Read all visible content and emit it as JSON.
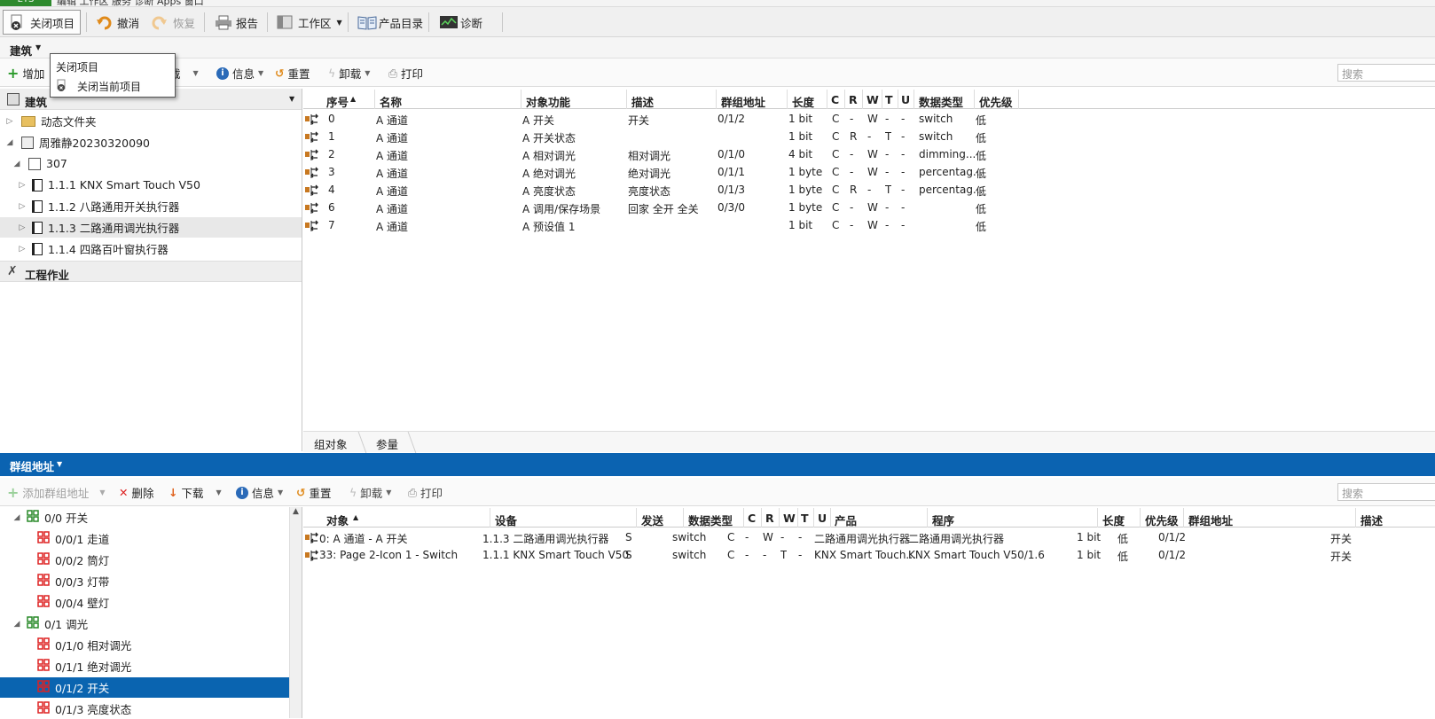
{
  "app": {
    "badge": "ETS",
    "menu": "编辑   工作区   服务   诊断   Apps   窗口"
  },
  "toolbar": {
    "close_project": "关闭项目",
    "undo": "撤消",
    "redo": "恢复",
    "report": "报告",
    "workspace": "工作区",
    "catalog": "产品目录",
    "diagnostics": "诊断"
  },
  "popup": {
    "title": "关闭项目",
    "item": "关闭当前项目"
  },
  "building_panel": {
    "title": "建筑",
    "toolbar": {
      "add": "增加",
      "delete": "删除",
      "download": "下载",
      "info": "信息",
      "reset": "重置",
      "unload": "卸载",
      "print": "打印",
      "search_placeholder": "搜索"
    },
    "tree_header": "建筑",
    "tree": [
      {
        "label": "动态文件夹"
      },
      {
        "label": "周雅静20230320090"
      },
      {
        "label": "307"
      },
      {
        "label": "1.1.1 KNX Smart Touch V50"
      },
      {
        "label": "1.1.2 八路通用开关执行器"
      },
      {
        "label": "1.1.3 二路通用调光执行器"
      },
      {
        "label": "1.1.4 四路百叶窗执行器"
      }
    ],
    "work_section": "工程作业"
  },
  "objects_grid": {
    "headers": {
      "num": "序号",
      "name": "名称",
      "func": "对象功能",
      "desc": "描述",
      "ga": "群组地址",
      "len": "长度",
      "c": "C",
      "r": "R",
      "w": "W",
      "t": "T",
      "u": "U",
      "dtype": "数据类型",
      "prio": "优先级"
    },
    "rows": [
      {
        "num": "0",
        "name": "A 通道",
        "func": "A 开关",
        "desc": "开关",
        "ga": "0/1/2",
        "len": "1 bit",
        "c": "C",
        "r": "-",
        "w": "W",
        "t": "-",
        "u": "-",
        "dtype": "switch",
        "prio": "低"
      },
      {
        "num": "1",
        "name": "A 通道",
        "func": "A 开关状态",
        "desc": "",
        "ga": "",
        "len": "1 bit",
        "c": "C",
        "r": "R",
        "w": "-",
        "t": "T",
        "u": "-",
        "dtype": "switch",
        "prio": "低"
      },
      {
        "num": "2",
        "name": "A 通道",
        "func": "A 相对调光",
        "desc": "相对调光",
        "ga": "0/1/0",
        "len": "4 bit",
        "c": "C",
        "r": "-",
        "w": "W",
        "t": "-",
        "u": "-",
        "dtype": "dimming...",
        "prio": "低"
      },
      {
        "num": "3",
        "name": "A 通道",
        "func": "A 绝对调光",
        "desc": "绝对调光",
        "ga": "0/1/1",
        "len": "1 byte",
        "c": "C",
        "r": "-",
        "w": "W",
        "t": "-",
        "u": "-",
        "dtype": "percentag...",
        "prio": "低"
      },
      {
        "num": "4",
        "name": "A 通道",
        "func": "A 亮度状态",
        "desc": "亮度状态",
        "ga": "0/1/3",
        "len": "1 byte",
        "c": "C",
        "r": "R",
        "w": "-",
        "t": "T",
        "u": "-",
        "dtype": "percentag...",
        "prio": "低"
      },
      {
        "num": "6",
        "name": "A 通道",
        "func": "A 调用/保存场景",
        "desc": "回家 全开 全关",
        "ga": "0/3/0",
        "len": "1 byte",
        "c": "C",
        "r": "-",
        "w": "W",
        "t": "-",
        "u": "-",
        "dtype": "",
        "prio": "低"
      },
      {
        "num": "7",
        "name": "A 通道",
        "func": "A 预设值 1",
        "desc": "",
        "ga": "",
        "len": "1 bit",
        "c": "C",
        "r": "-",
        "w": "W",
        "t": "-",
        "u": "-",
        "dtype": "",
        "prio": "低"
      }
    ],
    "tabs": [
      "组对象",
      "参量"
    ]
  },
  "ga_panel": {
    "title": "群组地址",
    "toolbar": {
      "add": "添加群组地址",
      "delete": "删除",
      "download": "下载",
      "info": "信息",
      "reset": "重置",
      "unload": "卸载",
      "print": "打印",
      "search_placeholder": "搜索"
    },
    "tree": [
      {
        "label": "0/0 开关"
      },
      {
        "label": "0/0/1 走道"
      },
      {
        "label": "0/0/2 筒灯"
      },
      {
        "label": "0/0/3 灯带"
      },
      {
        "label": "0/0/4 壁灯"
      },
      {
        "label": "0/1 调光"
      },
      {
        "label": "0/1/0 相对调光"
      },
      {
        "label": "0/1/1 绝对调光"
      },
      {
        "label": "0/1/2 开关"
      },
      {
        "label": "0/1/3 亮度状态"
      }
    ]
  },
  "links_grid": {
    "headers": {
      "obj": "对象",
      "dev": "设备",
      "send": "发送",
      "dtype": "数据类型",
      "c": "C",
      "r": "R",
      "w": "W",
      "t": "T",
      "u": "U",
      "product": "产品",
      "program": "程序",
      "len": "长度",
      "prio": "优先级",
      "ga": "群组地址",
      "desc": "描述"
    },
    "rows": [
      {
        "obj": "0: A 通道 - A 开关",
        "dev": "1.1.3 二路通用调光执行器",
        "send": "S",
        "dtype": "switch",
        "c": "C",
        "r": "-",
        "w": "W",
        "t": "-",
        "u": "-",
        "product": "二路通用调光执行器",
        "program": "二路通用调光执行器",
        "len": "1 bit",
        "prio": "低",
        "ga": "0/1/2",
        "desc": "开关"
      },
      {
        "obj": "33: Page 2-Icon 1 - Switch",
        "dev": "1.1.1 KNX Smart Touch V50",
        "send": "S",
        "dtype": "switch",
        "c": "C",
        "r": "-",
        "w": "-",
        "t": "T",
        "u": "-",
        "product": "KNX Smart Touch...",
        "program": "KNX Smart Touch V50/1.6",
        "len": "1 bit",
        "prio": "低",
        "ga": "0/1/2",
        "desc": "开关"
      }
    ]
  },
  "colors": {
    "accent": "#0b63b1",
    "ga_icon_red": "#d22",
    "ga_icon_green": "#2a8a2a"
  }
}
